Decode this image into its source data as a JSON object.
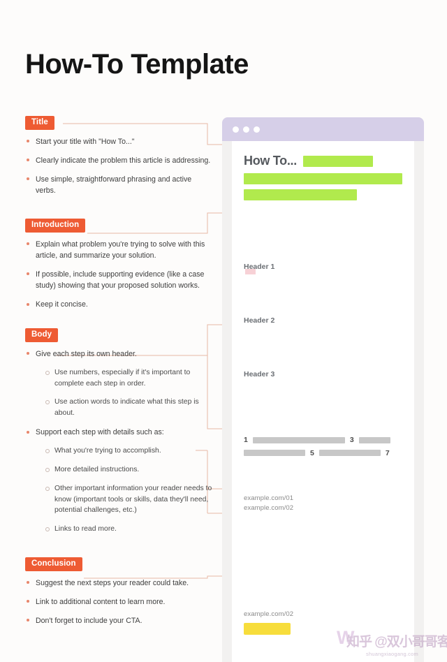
{
  "page": {
    "title": "How-To Template",
    "background_color": "#fdfcfb",
    "accent_color": "#ee5b33"
  },
  "sections": [
    {
      "badge": "Title",
      "bullets": [
        {
          "text": "Start your title with \"How To...\""
        },
        {
          "text": "Clearly indicate the problem this article is addressing."
        },
        {
          "text": "Use simple, straightforward phrasing and active verbs."
        }
      ]
    },
    {
      "badge": "Introduction",
      "bullets": [
        {
          "text": "Explain what problem you're trying to solve with this article, and summarize your solution."
        },
        {
          "text": "If possible, include supporting evidence (like a case study) showing that your proposed solution works."
        },
        {
          "text": "Keep it concise."
        }
      ]
    },
    {
      "badge": "Body",
      "bullets": [
        {
          "text": "Give each step its own header.",
          "sub": [
            "Use numbers, especially if it's important to complete each step in order.",
            "Use action words to indicate what this step is about."
          ]
        },
        {
          "text": "Support each step with details such as:",
          "sub": [
            "What you're trying to accomplish.",
            "More detailed instructions.",
            "Other important information your reader needs to know (important tools or skills, data they'll need, potential challenges, etc.)",
            "Links to read more."
          ]
        }
      ]
    },
    {
      "badge": "Conclusion",
      "bullets": [
        {
          "text": "Suggest the next steps your reader could take."
        },
        {
          "text": "Link to additional content to learn more."
        },
        {
          "text": "Don't forget to include your CTA."
        }
      ]
    }
  ],
  "mockup": {
    "window_dots": [
      "dot-1",
      "dot-2",
      "dot-3"
    ],
    "headline": "How To...",
    "headers": [
      "Header 1",
      "Header 2",
      "Header 3"
    ],
    "numbers": [
      "1",
      "3",
      "5",
      "7"
    ],
    "links": [
      "example.com/01",
      "example.com/02",
      "example.com/02"
    ],
    "colors": {
      "chrome": "#d6cfe8",
      "highlight_green": "#b1ea4d",
      "placeholder_grey": "#c7c7c7",
      "placeholder_lavender": "#cdc6e4",
      "cta_yellow": "#f7dd3c",
      "pink_mark": "#f6c9cf"
    }
  },
  "watermark": {
    "brand": "知乎 @双小哥哥客",
    "mark": "W",
    "url": "shuangxiaogang.com"
  }
}
